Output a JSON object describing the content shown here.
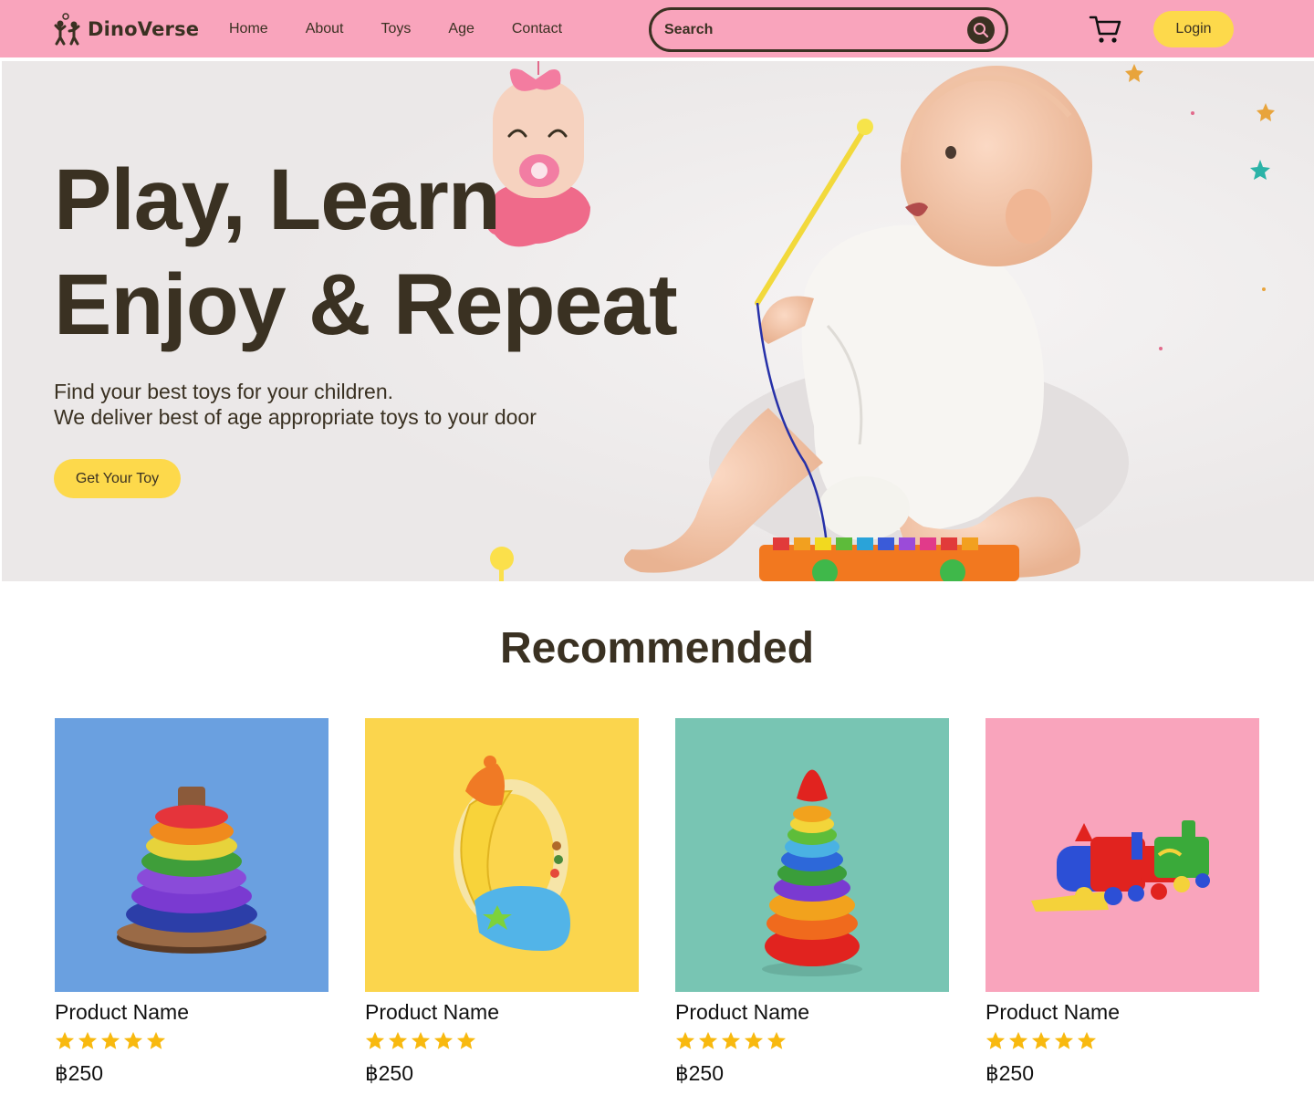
{
  "brand": {
    "name": "DinoVerse",
    "color": "#f9a4bc",
    "accent": "#fdd94b",
    "text_color": "#3a3122"
  },
  "nav": {
    "links": [
      "Home",
      "About",
      "Toys",
      "Age",
      "Contact"
    ],
    "search_placeholder": "Search",
    "cart_icon": "cart-icon",
    "search_icon": "search-icon",
    "login_label": "Login"
  },
  "hero": {
    "title_line1": "Play, Learn",
    "title_line2": "Enjoy & Repeat",
    "subtitle_line1": "Find your best toys for your children.",
    "subtitle_line2": "We deliver best of age appropriate toys to your door",
    "cta_label": "Get Your Toy"
  },
  "recommended": {
    "title": "Recommended",
    "products": [
      {
        "name": "Product Name",
        "price": "฿250",
        "rating": 5,
        "bg": "#6aa0e0"
      },
      {
        "name": "Product Name",
        "price": "฿250",
        "rating": 5,
        "bg": "#fbd54d"
      },
      {
        "name": "Product Name",
        "price": "฿250",
        "rating": 5,
        "bg": "#78c5b3"
      },
      {
        "name": "Product Name",
        "price": "฿250",
        "rating": 5,
        "bg": "#f9a4bc"
      }
    ]
  }
}
